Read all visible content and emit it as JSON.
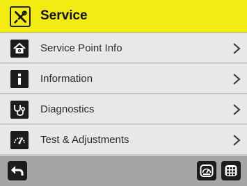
{
  "header": {
    "title": "Service",
    "icon": "tools-icon",
    "color": "#f2ec13"
  },
  "menu": {
    "items": [
      {
        "label": "Service Point Info",
        "icon": "house-gear-icon"
      },
      {
        "label": "Information",
        "icon": "info-icon"
      },
      {
        "label": "Diagnostics",
        "icon": "stethoscope-icon"
      },
      {
        "label": "Test & Adjustments",
        "icon": "gauge-adjust-icon"
      }
    ]
  },
  "footer": {
    "back_icon": "back-arrow-icon",
    "dashboard_icon": "dashboard-gauge-icon",
    "grid_icon": "grid-menu-icon"
  }
}
